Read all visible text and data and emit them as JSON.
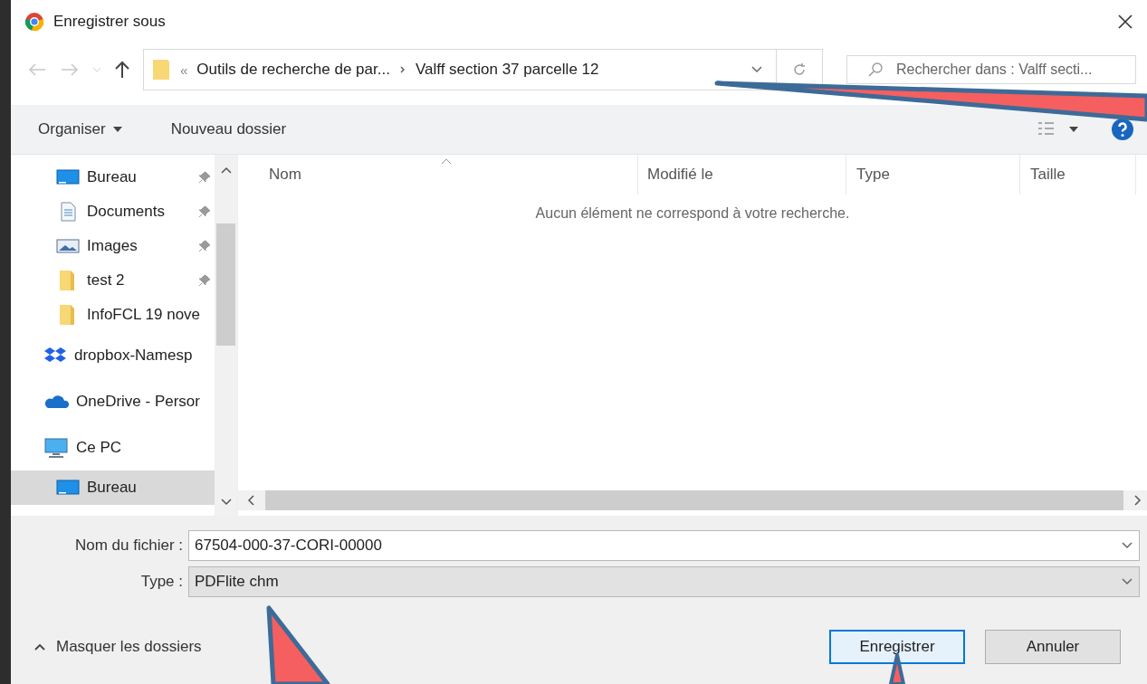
{
  "window": {
    "title": "Enregistrer sous"
  },
  "address_bar": {
    "overflow": "«",
    "segments": [
      "Outils de recherche de par...",
      "Valff section 37 parcelle 12"
    ]
  },
  "search": {
    "placeholder": "Rechercher dans : Valff secti..."
  },
  "toolbar": {
    "organize": "Organiser",
    "new_folder": "Nouveau dossier"
  },
  "sidebar": {
    "pinned_items": [
      {
        "label": "Bureau",
        "kind": "desktop",
        "pinned": true
      },
      {
        "label": "Documents",
        "kind": "documents",
        "pinned": true
      },
      {
        "label": "Images",
        "kind": "images",
        "pinned": true
      },
      {
        "label": "test 2",
        "kind": "folder",
        "pinned": true
      },
      {
        "label": "InfoFCL 19 nove",
        "kind": "folder",
        "pinned": false
      }
    ],
    "items": [
      {
        "label": "dropbox-Namesp",
        "kind": "dropbox",
        "selected": false
      },
      {
        "label": "OneDrive - Persor",
        "kind": "onedrive",
        "selected": false
      },
      {
        "label": "Ce PC",
        "kind": "pc",
        "selected": false,
        "children": [
          {
            "label": "Bureau",
            "kind": "desktop",
            "selected": true
          }
        ]
      }
    ]
  },
  "table": {
    "columns": [
      "Nom",
      "Modifié le",
      "Type",
      "Taille"
    ],
    "empty_message": "Aucun élément ne correspond à votre recherche."
  },
  "form": {
    "filename_label": "Nom du fichier :",
    "filename": "67504-000-37-CORI-00000",
    "type_label": "Type :",
    "type": "PDFlite chm"
  },
  "hide_folders": "Masquer les dossiers",
  "buttons": [
    {
      "label": "Enregistrer",
      "default": true
    },
    {
      "label": "Annuler",
      "default": false
    }
  ]
}
